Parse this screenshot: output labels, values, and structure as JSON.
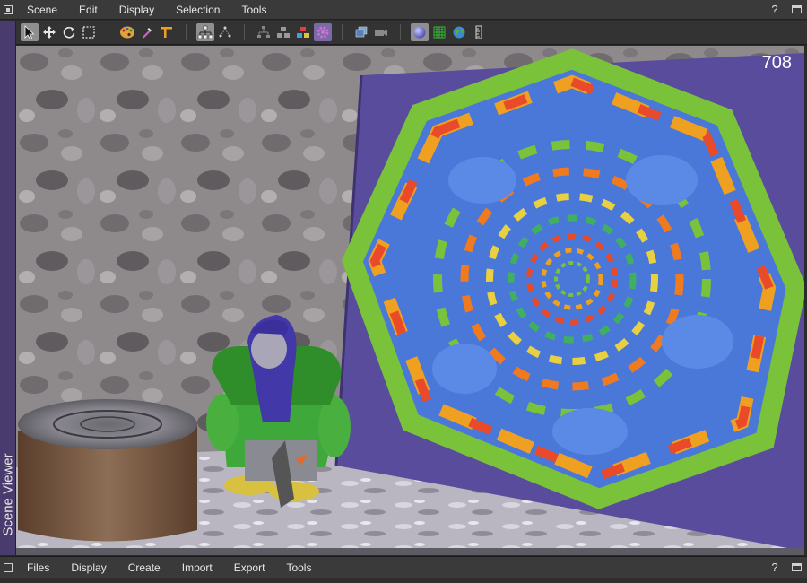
{
  "menubar": {
    "items": [
      "Scene",
      "Edit",
      "Display",
      "Selection",
      "Tools"
    ],
    "help": "?"
  },
  "toolbar": {
    "groups": [
      [
        "select-arrow-icon",
        "move-icon",
        "rotate-icon",
        "marquee-select-icon"
      ],
      [
        "paint-palette-icon",
        "eyedropper-icon",
        "measure-icon"
      ],
      [
        "hierarchy-icon",
        "nodes-icon"
      ],
      [
        "tree-icon",
        "cubes-icon",
        "colored-blocks-icon",
        "gear-lit-icon"
      ],
      [
        "stack-icon",
        "camera-icon"
      ],
      [
        "sphere-icon",
        "grid-icon",
        "globe-icon",
        "ruler-icon"
      ]
    ]
  },
  "side_tab": {
    "label": "Scene Viewer"
  },
  "viewport": {
    "fps": "708"
  },
  "bottombar": {
    "items": [
      "Files",
      "Display",
      "Create",
      "Import",
      "Export",
      "Tools"
    ],
    "help": "?"
  },
  "colors": {
    "accent": "#4a3b6e",
    "panel": "#5a4c9c",
    "bar": "#3a3a3a"
  }
}
